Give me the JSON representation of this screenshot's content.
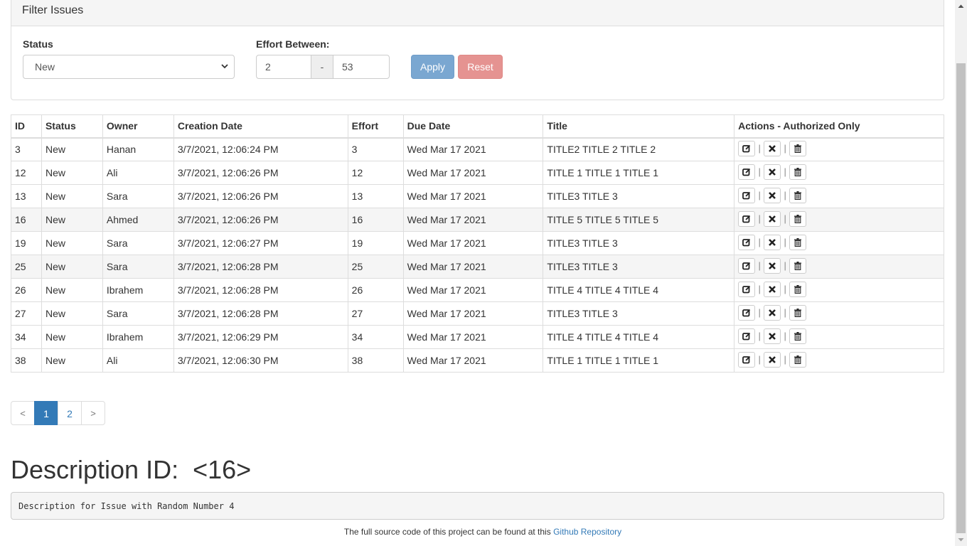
{
  "filter": {
    "panel_title": "Filter Issues",
    "status_label": "Status",
    "status_value": "New",
    "effort_label": "Effort Between:",
    "effort_min": "2",
    "effort_separator": "-",
    "effort_max": "53",
    "apply_label": "Apply",
    "reset_label": "Reset"
  },
  "table": {
    "headers": [
      "ID",
      "Status",
      "Owner",
      "Creation Date",
      "Effort",
      "Due Date",
      "Title",
      "Actions - Authorized Only"
    ],
    "rows": [
      {
        "id": "3",
        "status": "New",
        "owner": "Hanan",
        "created": "3/7/2021, 12:06:24 PM",
        "effort": "3",
        "due": "Wed Mar 17 2021",
        "title": "TITLE2 TITLE 2 TITLE 2"
      },
      {
        "id": "12",
        "status": "New",
        "owner": "Ali",
        "created": "3/7/2021, 12:06:26 PM",
        "effort": "12",
        "due": "Wed Mar 17 2021",
        "title": "TITLE 1 TITLE 1 TITLE 1"
      },
      {
        "id": "13",
        "status": "New",
        "owner": "Sara",
        "created": "3/7/2021, 12:06:26 PM",
        "effort": "13",
        "due": "Wed Mar 17 2021",
        "title": "TITLE3 TITLE 3"
      },
      {
        "id": "16",
        "status": "New",
        "owner": "Ahmed",
        "created": "3/7/2021, 12:06:26 PM",
        "effort": "16",
        "due": "Wed Mar 17 2021",
        "title": "TITLE 5 TITLE 5 TITLE 5"
      },
      {
        "id": "19",
        "status": "New",
        "owner": "Sara",
        "created": "3/7/2021, 12:06:27 PM",
        "effort": "19",
        "due": "Wed Mar 17 2021",
        "title": "TITLE3 TITLE 3"
      },
      {
        "id": "25",
        "status": "New",
        "owner": "Sara",
        "created": "3/7/2021, 12:06:28 PM",
        "effort": "25",
        "due": "Wed Mar 17 2021",
        "title": "TITLE3 TITLE 3"
      },
      {
        "id": "26",
        "status": "New",
        "owner": "Ibrahem",
        "created": "3/7/2021, 12:06:28 PM",
        "effort": "26",
        "due": "Wed Mar 17 2021",
        "title": "TITLE 4 TITLE 4 TITLE 4"
      },
      {
        "id": "27",
        "status": "New",
        "owner": "Sara",
        "created": "3/7/2021, 12:06:28 PM",
        "effort": "27",
        "due": "Wed Mar 17 2021",
        "title": "TITLE3 TITLE 3"
      },
      {
        "id": "34",
        "status": "New",
        "owner": "Ibrahem",
        "created": "3/7/2021, 12:06:29 PM",
        "effort": "34",
        "due": "Wed Mar 17 2021",
        "title": "TITLE 4 TITLE 4 TITLE 4"
      },
      {
        "id": "38",
        "status": "New",
        "owner": "Ali",
        "created": "3/7/2021, 12:06:30 PM",
        "effort": "38",
        "due": "Wed Mar 17 2021",
        "title": "TITLE 1 TITLE 1 TITLE 1"
      }
    ],
    "highlighted_row_ids": [
      "16",
      "25"
    ],
    "action_icons": [
      "edit-icon",
      "close-icon",
      "trash-icon"
    ],
    "action_separator": "|"
  },
  "pagination": {
    "prev": "<",
    "pages": [
      "1",
      "2"
    ],
    "active_page": "1",
    "next": ">"
  },
  "description": {
    "title": "Description ID:  <16>",
    "text": "Description for Issue with Random Number 4"
  },
  "footer": {
    "text": "The full source code of this project can be found at this ",
    "link_label": "Github Repository"
  },
  "colors": {
    "primary": "#337ab7",
    "apply": "#7aa7d1",
    "reset": "#e59391",
    "highlight_row": "#f5f5f5"
  }
}
